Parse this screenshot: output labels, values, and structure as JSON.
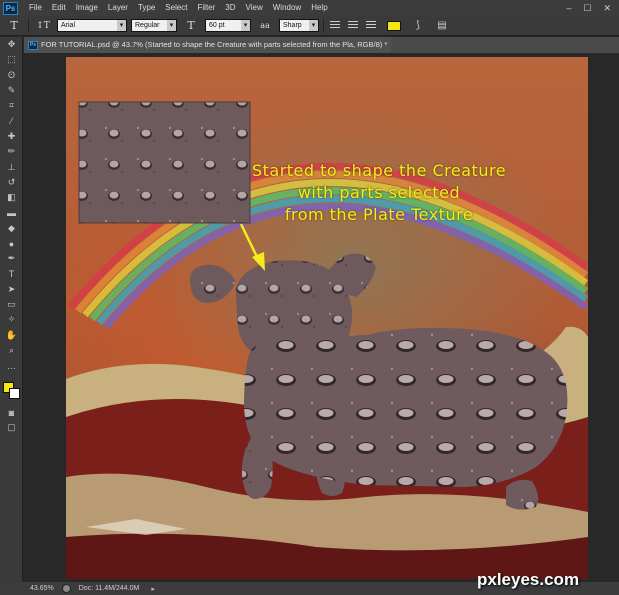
{
  "app": {
    "logo": "Ps"
  },
  "menu": [
    "File",
    "Edit",
    "Image",
    "Layer",
    "Type",
    "Select",
    "Filter",
    "3D",
    "View",
    "Window",
    "Help"
  ],
  "window_controls": [
    "–",
    "☐",
    "✕"
  ],
  "options": {
    "tool_glyph": "T",
    "orientation_glyph": "↕T",
    "font_family": "Arial",
    "font_style": "Regular",
    "size_glyph": "T",
    "font_size": "60 pt",
    "antialias_glyph": "aa",
    "antialias": "Sharp",
    "text_color": "#f5e70b",
    "warp_glyph": "⟆",
    "panels_glyph": "▤"
  },
  "tools": [
    {
      "name": "move-tool",
      "glyph": "✥"
    },
    {
      "name": "marquee-tool",
      "glyph": "⬚"
    },
    {
      "name": "lasso-tool",
      "glyph": "ʘ"
    },
    {
      "name": "quick-select-tool",
      "glyph": "✎"
    },
    {
      "name": "crop-tool",
      "glyph": "⌗"
    },
    {
      "name": "eyedropper-tool",
      "glyph": "⁄"
    },
    {
      "name": "healing-tool",
      "glyph": "✚"
    },
    {
      "name": "brush-tool",
      "glyph": "✏"
    },
    {
      "name": "stamp-tool",
      "glyph": "⊥"
    },
    {
      "name": "history-brush-tool",
      "glyph": "↺"
    },
    {
      "name": "eraser-tool",
      "glyph": "◧"
    },
    {
      "name": "gradient-tool",
      "glyph": "▬"
    },
    {
      "name": "blur-tool",
      "glyph": "◆"
    },
    {
      "name": "dodge-tool",
      "glyph": "●"
    },
    {
      "name": "pen-tool",
      "glyph": "✒"
    },
    {
      "name": "type-tool",
      "glyph": "T"
    },
    {
      "name": "path-select-tool",
      "glyph": "➤"
    },
    {
      "name": "shape-tool",
      "glyph": "▭"
    },
    {
      "name": "3d-tool",
      "glyph": "✧"
    },
    {
      "name": "hand-tool",
      "glyph": "✋"
    },
    {
      "name": "zoom-tool",
      "glyph": "⌕"
    },
    {
      "name": "more-tools",
      "glyph": "…"
    }
  ],
  "bottom_tools": [
    {
      "name": "quick-mask",
      "glyph": "◙"
    },
    {
      "name": "screen-mode",
      "glyph": "▢"
    }
  ],
  "colors": {
    "foreground": "#f5ea10",
    "background": "#ffffff"
  },
  "document": {
    "tab_title": "FOR TUTORIAL.psd @ 43.7% (Started to shape the Creature with parts selected  from the Pla, RGB/8) *"
  },
  "canvas": {
    "caption_lines": [
      "Started to shape the Creature",
      "with parts selected",
      "from the Plate Texture"
    ]
  },
  "status": {
    "zoom": "43.65%",
    "doc": "Doc: 11.4M/244.0M",
    "arrow": "▸"
  },
  "watermark": "pxleyes.com"
}
